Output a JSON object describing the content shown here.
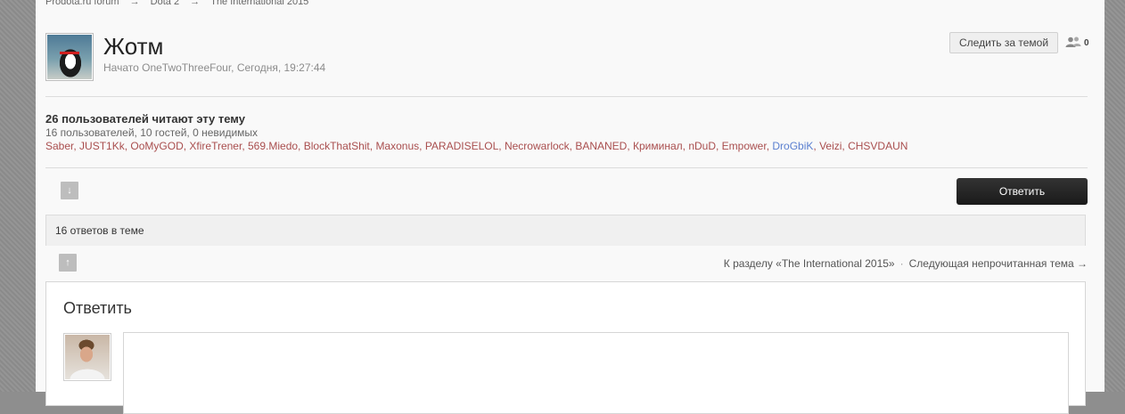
{
  "breadcrumb": [
    "Prodota.ru forum",
    "Dota 2",
    "The International 2015"
  ],
  "breadcrumb_sep": "→",
  "topic": {
    "title": "Жотм",
    "meta": "Начато OneTwoThreeFour, Сегодня, 19:27:44",
    "follow_label": "Следить за темой",
    "followers_count": "0"
  },
  "readers": {
    "title": "26 пользователей читают эту тему",
    "stats": "16 пользователей, 10 гостей, 0 невидимых",
    "users": [
      {
        "name": "Saber",
        "color": "#a94e4e"
      },
      {
        "name": "JUST1Kk",
        "color": "#a94e4e"
      },
      {
        "name": "OoMyGOD",
        "color": "#a94e4e"
      },
      {
        "name": "XfireTrener",
        "color": "#a94e4e"
      },
      {
        "name": "569.Miedo",
        "color": "#a94e4e"
      },
      {
        "name": "BlockThatShit",
        "color": "#a94e4e"
      },
      {
        "name": "Maxonus",
        "color": "#a94e4e"
      },
      {
        "name": "PARADISELOL",
        "color": "#a94e4e"
      },
      {
        "name": "Necrowarlock",
        "color": "#a94e4e"
      },
      {
        "name": "BANANED",
        "color": "#a94e4e"
      },
      {
        "name": "Криминал",
        "color": "#a94e4e"
      },
      {
        "name": "nDuD",
        "color": "#a94e4e"
      },
      {
        "name": "Empower",
        "color": "#a94e4e"
      },
      {
        "name": "DroGbiK",
        "color": "#5a7fd0"
      },
      {
        "name": "Veizi",
        "color": "#a94e4e"
      },
      {
        "name": "CHSVDAUN",
        "color": "#a94e4e"
      }
    ]
  },
  "actions": {
    "scroll_down_icon": "↓",
    "scroll_up_icon": "↑",
    "reply_label": "Ответить"
  },
  "replies_count": "16 ответов в теме",
  "nav": {
    "back_label": "К разделу «The International 2015»",
    "next_label": "Следующая непрочитанная тема →"
  },
  "reply_box": {
    "heading": "Ответить"
  }
}
